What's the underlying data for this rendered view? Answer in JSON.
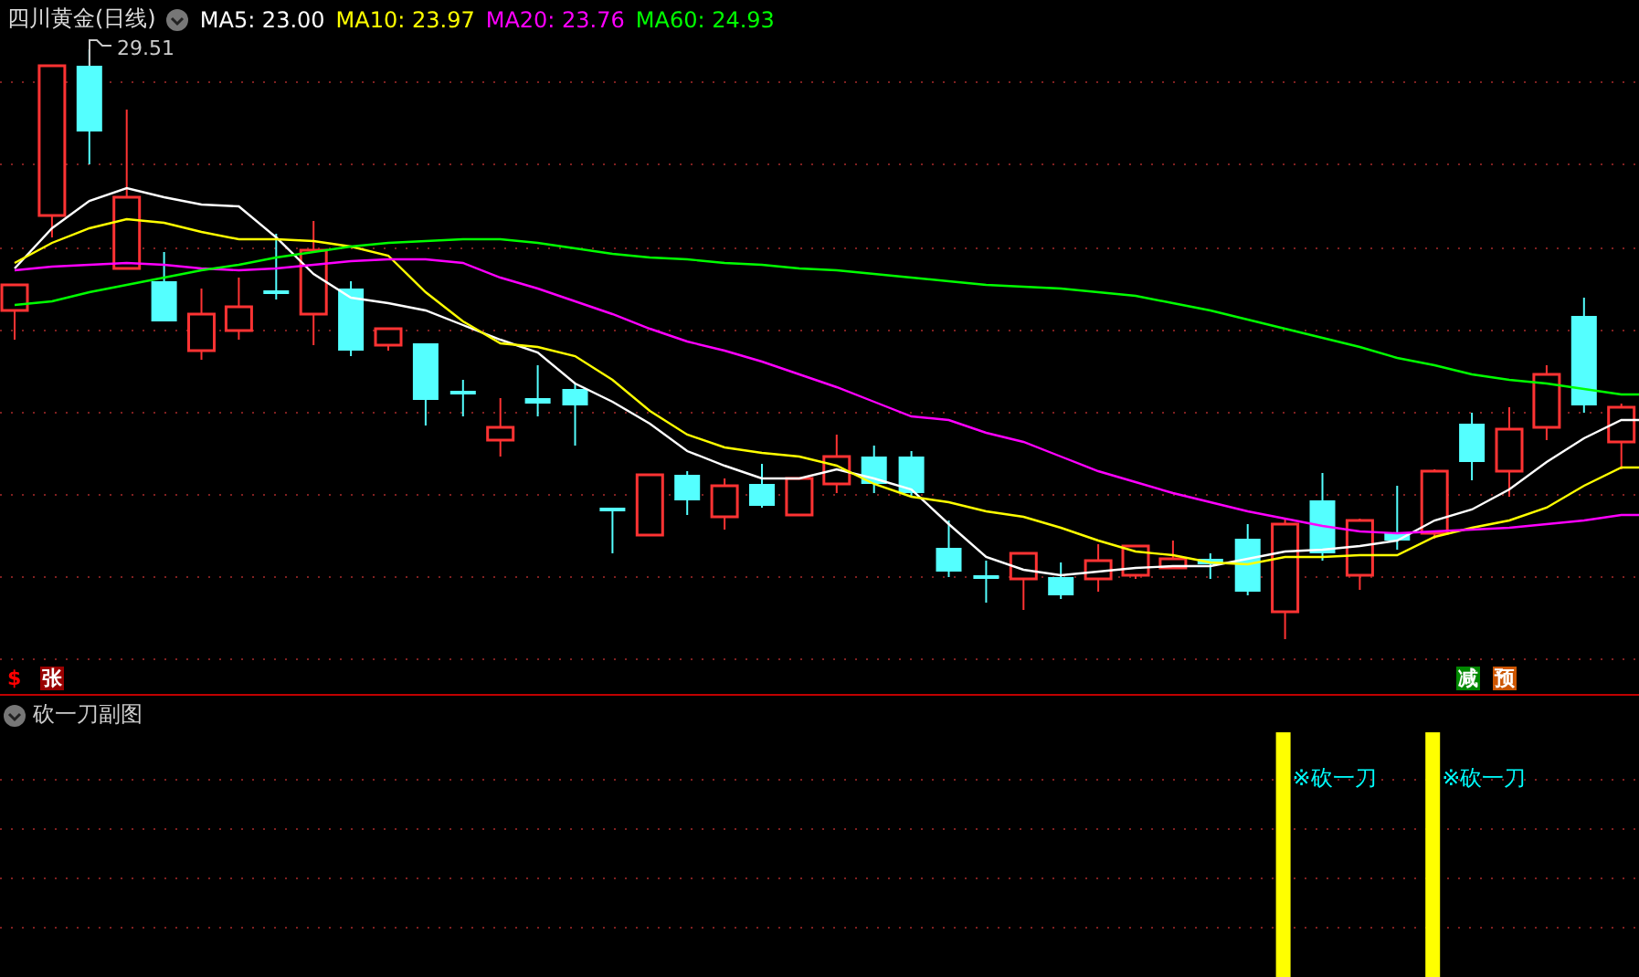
{
  "header": {
    "title": "四川黄金(日线)",
    "indicators": [
      {
        "label": "MA5: 23.00",
        "color": "#ffffff"
      },
      {
        "label": "MA10: 23.97",
        "color": "#ffff00"
      },
      {
        "label": "MA20: 23.76",
        "color": "#ff00ff"
      },
      {
        "label": "MA60: 24.93",
        "color": "#00ff00"
      }
    ]
  },
  "high_label": "29.51",
  "markers": [
    {
      "kind": "glyph",
      "text": "$",
      "color": "#ff0000"
    },
    {
      "kind": "badge",
      "text": "张",
      "color": "#990000"
    },
    {
      "kind": "badge",
      "text": "减",
      "color": "#008800"
    },
    {
      "kind": "badge",
      "text": "预",
      "color": "#cc5500"
    }
  ],
  "subchart": {
    "title": "砍一刀副图",
    "signals": [
      {
        "label": "※砍一刀"
      },
      {
        "label": "※砍一刀"
      }
    ]
  }
}
